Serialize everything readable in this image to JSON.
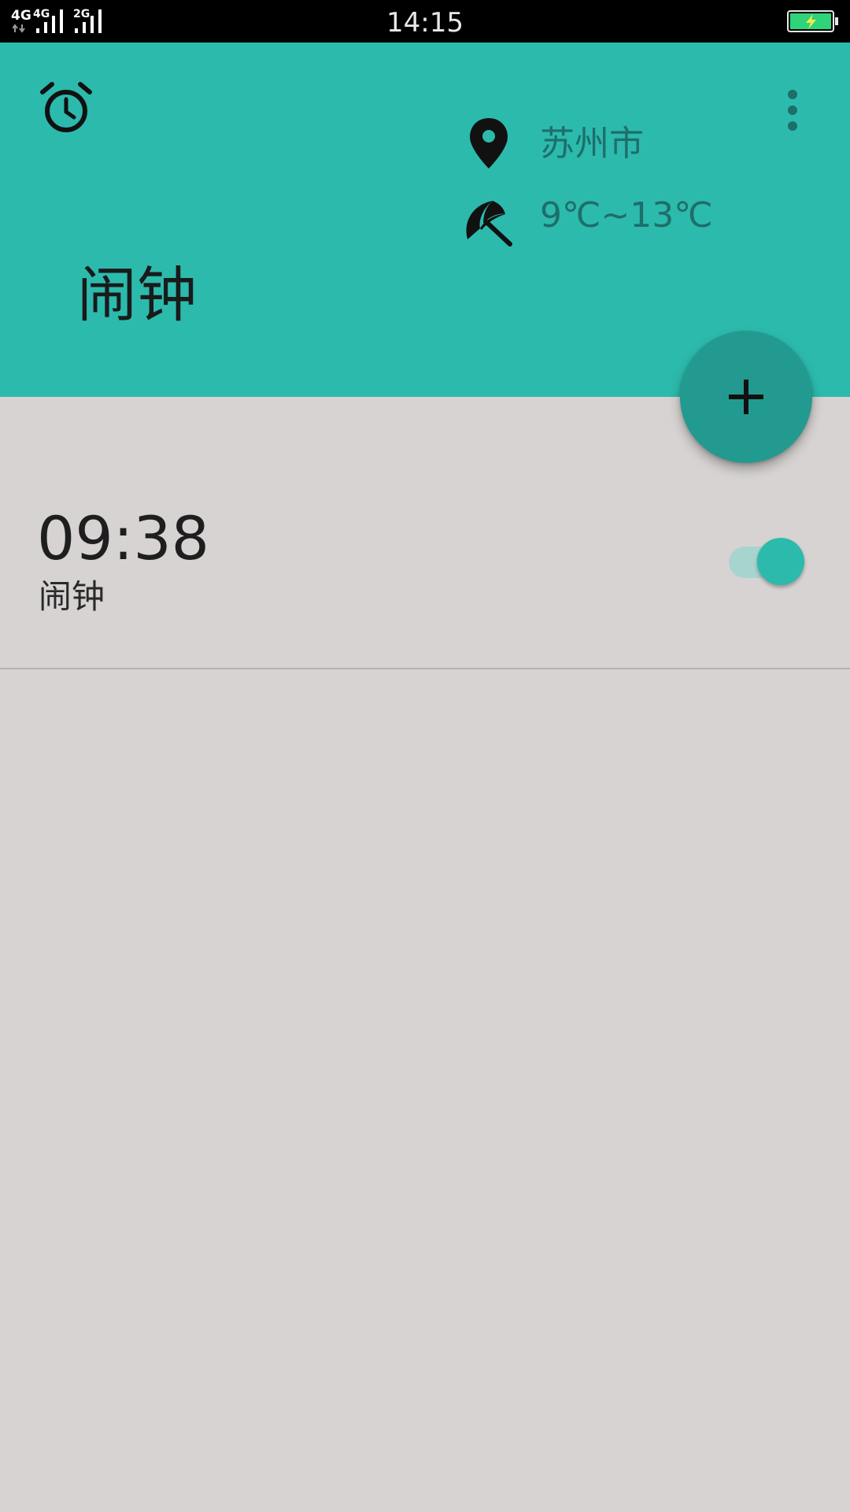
{
  "status_bar": {
    "time": "14:15",
    "sim1_label_a": "4G",
    "sim1_label_b": "4G",
    "sim2_label": "2G",
    "battery_state": "charging",
    "battery_color": "#2ed37a"
  },
  "header": {
    "title": "闹钟",
    "location": "苏州市",
    "temperature": "9℃~13℃",
    "background_color": "#2cbaad",
    "alarm_icon": "alarm-clock-icon",
    "more_icon": "more-vertical-icon",
    "location_icon": "map-pin-icon",
    "weather_icon": "umbrella-icon"
  },
  "fab": {
    "icon": "plus-icon",
    "color": "#239a8f"
  },
  "alarms": [
    {
      "time": "09:38",
      "label": "闹钟",
      "enabled": true
    }
  ]
}
